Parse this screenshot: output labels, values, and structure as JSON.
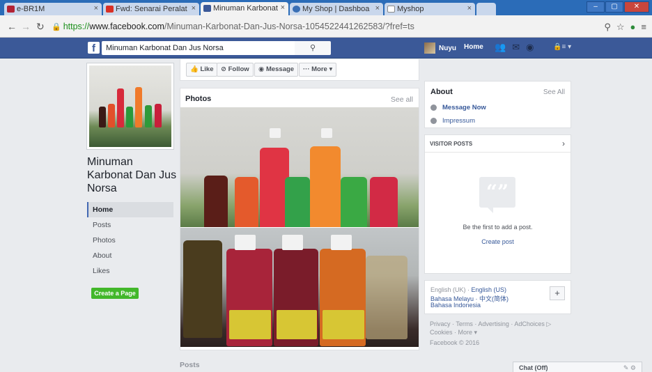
{
  "browser": {
    "tabs": [
      {
        "label": "e-BR1M",
        "icon": "flag-icon",
        "color": "#b22234"
      },
      {
        "label": "Fwd: Senarai Peralat",
        "icon": "gmail-icon",
        "color": "#d93025"
      },
      {
        "label": "Minuman Karbonat",
        "icon": "facebook-icon",
        "color": "#3b5998"
      },
      {
        "label": "My Shop | Dashboa",
        "icon": "shop-icon",
        "color": "#3a6fb5"
      },
      {
        "label": "Myshop",
        "icon": "page-icon",
        "color": "#8a8a8a"
      }
    ],
    "url_https": "https://",
    "url_host": "www.facebook.com",
    "url_path": "/Minuman-Karbonat-Dan-Jus-Norsa-1054522441262583/?fref=ts",
    "window_buttons": [
      "–",
      "▢",
      "✕"
    ]
  },
  "fb": {
    "search_value": "Minuman Karbonat Dan Jus Norsa",
    "user_name": "Nuyu",
    "home_label": "Home"
  },
  "page": {
    "name": "Minuman Karbonat Dan Jus Norsa",
    "nav": [
      "Home",
      "Posts",
      "Photos",
      "About",
      "Likes"
    ],
    "create_page_label": "Create a Page",
    "actions": {
      "like": "Like",
      "follow": "Follow",
      "message": "Message",
      "more": "More"
    },
    "photos": {
      "title": "Photos",
      "see_all": "See all"
    },
    "posts_label": "Posts"
  },
  "about": {
    "title": "About",
    "see_all": "See All",
    "message_now": "Message Now",
    "impressum": "Impressum"
  },
  "visitor_posts": {
    "title": "VISITOR POSTS",
    "empty_text": "Be the first to add a post.",
    "create_post": "Create post"
  },
  "languages": {
    "current": "English (UK)",
    "line1_rest": "English (US)",
    "line2": "Bahasa Melayu · 中文(简体)",
    "line3": "Bahasa Indonesia"
  },
  "footer": {
    "links_line1": "Privacy · Terms · Advertising · AdChoices ▷",
    "links_line2": "Cookies · More ▾",
    "copyright": "Facebook © 2016"
  },
  "chat": {
    "label": "Chat (Off)"
  }
}
